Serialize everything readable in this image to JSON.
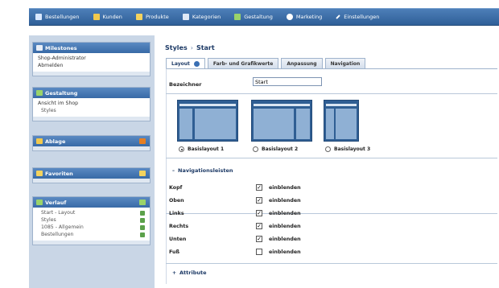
{
  "nav": {
    "items": [
      {
        "label": "Bestellungen",
        "icon": "orders-icon",
        "color": "#d9e8ff"
      },
      {
        "label": "Kunden",
        "icon": "customers-icon",
        "color": "#f2c94c"
      },
      {
        "label": "Produkte",
        "icon": "products-icon",
        "color": "#f4d35e"
      },
      {
        "label": "Kategorien",
        "icon": "categories-icon",
        "color": "#dfe9f6"
      },
      {
        "label": "Gestaltung",
        "icon": "design-icon",
        "color": "#9ad36a"
      },
      {
        "label": "Marketing",
        "icon": "marketing-icon",
        "color": "#ffffff"
      },
      {
        "label": "Einstellungen",
        "icon": "settings-icon",
        "color": "#ffffff"
      }
    ]
  },
  "sidebar": {
    "milestones": {
      "title": "Milestones",
      "links": [
        "Shop-Administrator",
        "Abmelden"
      ]
    },
    "gestaltung": {
      "title": "Gestaltung",
      "links": [
        "Ansicht im Shop",
        "Styles"
      ]
    },
    "ablage": {
      "title": "Ablage"
    },
    "favoriten": {
      "title": "Favoriten"
    },
    "verlauf": {
      "title": "Verlauf",
      "links": [
        "Start - Layout",
        "Styles",
        "1085 - Allgemein",
        "Bestellungen"
      ]
    }
  },
  "breadcrumb": {
    "parent": "Styles",
    "separator": "›",
    "current": "Start"
  },
  "tabs": [
    "Layout",
    "Farb- und Grafikwerte",
    "Anpassung",
    "Navigation"
  ],
  "form": {
    "label": "Bezeichner",
    "value": "Start"
  },
  "layouts": [
    {
      "label": "Basislayout 1",
      "selected": true
    },
    {
      "label": "Basislayout 2",
      "selected": false
    },
    {
      "label": "Basislayout 3",
      "selected": false
    }
  ],
  "navigation_section": {
    "title": "Navigationsleisten",
    "checkbox_label": "einblenden",
    "rows": [
      {
        "label": "Kopf",
        "checked": true
      },
      {
        "label": "Oben",
        "checked": true
      },
      {
        "label": "Links",
        "checked": true
      },
      {
        "label": "Rechts",
        "checked": true
      },
      {
        "label": "Unten",
        "checked": true
      },
      {
        "label": "Fuß",
        "checked": false
      }
    ]
  },
  "attribute_section": {
    "title": "Attribute"
  },
  "colors": {
    "nav_bar": "#3a6aa6",
    "sidebar_bg": "#c9d6e6",
    "accent": "#1d3a66"
  }
}
